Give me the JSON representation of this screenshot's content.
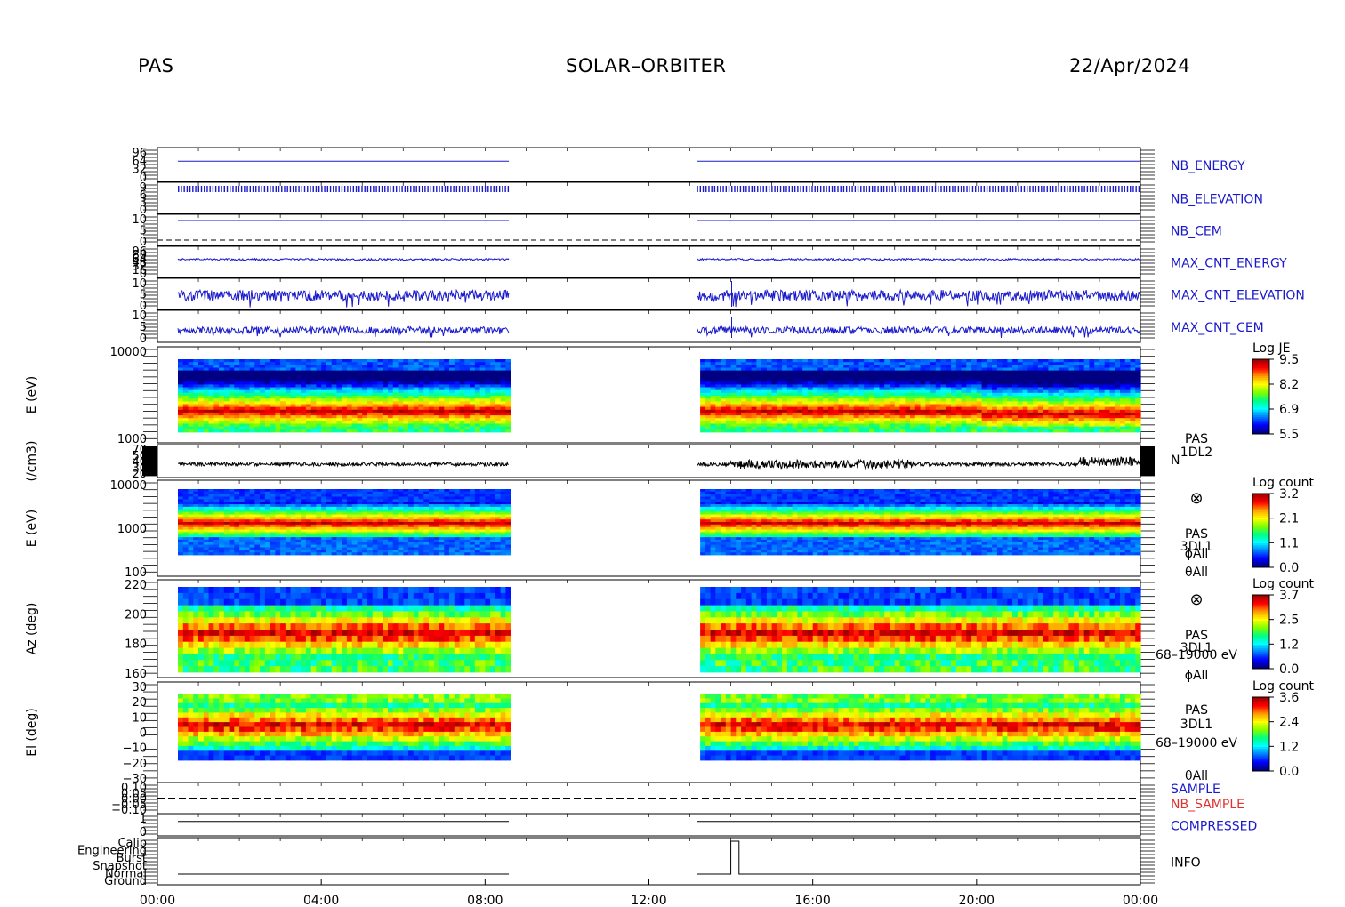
{
  "header": {
    "instrument": "PAS",
    "mission": "SOLAR–ORBITER",
    "date": "22/Apr/2024"
  },
  "colors": {
    "blue_trace": "#1a1acc",
    "red_trace": "#e03030",
    "black_trace": "#000000",
    "spectrogram_scale": [
      "#000080",
      "#0000ff",
      "#0080ff",
      "#00ffff",
      "#00ff80",
      "#80ff00",
      "#ffff00",
      "#ff8000",
      "#ff0000",
      "#a00000"
    ]
  },
  "chart_data": {
    "type": "heatmap",
    "x_range": [
      "00:00",
      "24:00"
    ],
    "x_ticks": [
      "00:00",
      "04:00",
      "08:00",
      "12:00",
      "16:00",
      "20:00",
      "00:00"
    ],
    "data_gaps": [
      [
        "08:35",
        "13:10"
      ]
    ],
    "panels": [
      {
        "label": "NB_ENERGY",
        "color": "blue",
        "ticks": [
          "96",
          "64",
          "32",
          "0"
        ]
      },
      {
        "label": "NB_ELEVATION",
        "color": "blue",
        "ticks": [
          "9",
          "6",
          "3",
          "0"
        ]
      },
      {
        "label": "NB_CEM",
        "color": "blue",
        "ticks": [
          "10",
          "5",
          "0"
        ]
      },
      {
        "label": "MAX_CNT_ENERGY",
        "color": "blue",
        "ticks": [
          "96",
          "80",
          "64",
          "48",
          "32",
          "16",
          "0"
        ]
      },
      {
        "label": "MAX_CNT_ELEVATION",
        "color": "blue",
        "ticks": [
          "10",
          "5",
          "0"
        ]
      },
      {
        "label": "MAX_CNT_CEM",
        "color": "blue",
        "ticks": [
          "10",
          "5",
          "0"
        ]
      },
      {
        "ylabel": "E (eV)",
        "type": "spectrogram",
        "scale": "log",
        "ticks": [
          "10000",
          "1000"
        ],
        "colorbar": {
          "title": "Log JE",
          "ticks": [
            "9.5",
            "8.2",
            "6.9",
            "5.5"
          ]
        }
      },
      {
        "ylabel": "(/cm3)",
        "type": "line",
        "label_lines": [
          "PAS",
          "1DL2"
        ],
        "side_label": "N",
        "ticks": [
          "70",
          "50",
          "40",
          "30",
          "20"
        ]
      },
      {
        "ylabel": "E (eV)",
        "type": "spectrogram",
        "scale": "log",
        "ticks": [
          "10000",
          "1000",
          "100"
        ],
        "label_lines": [
          "PAS",
          "3DL1",
          "ϕAll",
          "θAll"
        ],
        "symbol": "⊗",
        "colorbar": {
          "title": "Log count",
          "ticks": [
            "3.2",
            "2.1",
            "1.1",
            "0.0"
          ]
        }
      },
      {
        "ylabel": "Az (deg)",
        "type": "spectrogram",
        "ticks": [
          "220",
          "200",
          "180",
          "160"
        ],
        "label_lines": [
          "PAS",
          "3DL1",
          "68–19000 eV",
          "ϕAll"
        ],
        "symbol": "⊗",
        "colorbar": {
          "title": "Log count",
          "ticks": [
            "3.7",
            "2.5",
            "1.2",
            "0.0"
          ]
        }
      },
      {
        "ylabel": "El (deg)",
        "type": "spectrogram",
        "ticks": [
          "30",
          "20",
          "10",
          "0",
          "−10",
          "−20",
          "−30"
        ],
        "label_lines": [
          "PAS",
          "3DL1",
          "68–19000 eV",
          "θAll"
        ],
        "colorbar": {
          "title": "Log count",
          "ticks": [
            "3.6",
            "2.4",
            "1.2",
            "0.0"
          ]
        }
      },
      {
        "labels": [
          "SAMPLE",
          "NB_SAMPLE"
        ],
        "label_colors": [
          "blue",
          "red"
        ],
        "ticks": [
          "0.10",
          "0.05",
          "0.00",
          "−0.05",
          "−0.10"
        ]
      },
      {
        "label": "COMPRESSED",
        "color": "blue",
        "ticks": [
          "1",
          "0"
        ]
      },
      {
        "label": "INFO",
        "color": "black",
        "ticks": [
          "Calib",
          "Engineering",
          "Burst",
          "Snapshot",
          "Normal",
          "Ground"
        ]
      }
    ]
  }
}
